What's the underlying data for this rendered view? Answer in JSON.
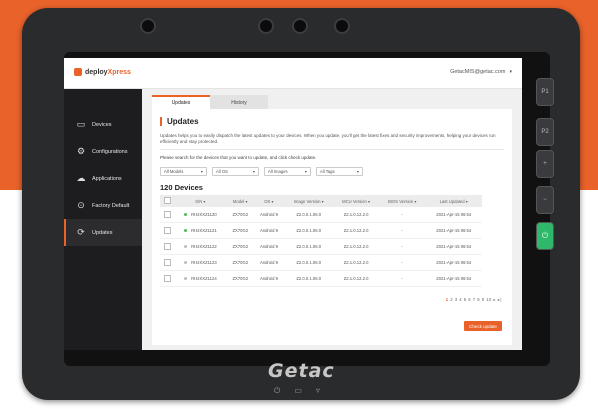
{
  "colors": {
    "accent": "#e8622a",
    "online": "#4bbd5a",
    "offline": "#bdbdbd"
  },
  "device": {
    "brand": "Getac"
  },
  "hardware_buttons": [
    "P1",
    "P2",
    "+",
    "−",
    "⏻"
  ],
  "app": {
    "logo": {
      "prefix": "deploy",
      "suffix": "Xpress"
    },
    "user": {
      "email": "GetacMIS@getac.com",
      "caret": "▾"
    }
  },
  "sidebar": {
    "items": [
      {
        "label": "Devices",
        "icon": "devices-icon",
        "glyph": "▭"
      },
      {
        "label": "Configurations",
        "icon": "configurations-icon",
        "glyph": "⚙"
      },
      {
        "label": "Applications",
        "icon": "applications-icon",
        "glyph": "☁"
      },
      {
        "label": "Factory Default",
        "icon": "factory-default-icon",
        "glyph": "⊙"
      },
      {
        "label": "Updates",
        "icon": "updates-icon",
        "glyph": "⟳",
        "active": true
      }
    ]
  },
  "tabs": [
    {
      "label": "Updates",
      "active": true
    },
    {
      "label": "History",
      "active": false
    }
  ],
  "page": {
    "title": "Updates",
    "description": "Updates helps you to easily dispatch the latest updates to your devices. When you update, you'll get the latest fixes and security improvements, helping your devices run efficiently and stay protected.",
    "hint": "Please search for the devices that you want to update, and click check update.",
    "filters": [
      {
        "value": "All Models"
      },
      {
        "value": "All OS"
      },
      {
        "value": "All Images"
      },
      {
        "value": "All Tags"
      }
    ],
    "count_label": "120 Devices"
  },
  "table": {
    "headers": [
      "S/N",
      "Model",
      "OS",
      "Image Version",
      "MCU Version",
      "BIOS Version",
      "Last Updated"
    ],
    "rows": [
      {
        "status": "online",
        "sn": "RH2XXZ1120",
        "model": "ZX70G2",
        "os": "Android 9",
        "image": "Z2.0.0.1.06.0",
        "mcu": "Z2.1.0.12.2.0",
        "bios": "-",
        "updated": "2021-Apr-15 06:54"
      },
      {
        "status": "online",
        "sn": "RH2XXZ1121",
        "model": "ZX70G2",
        "os": "Android 9",
        "image": "Z2.0.0.1.06.0",
        "mcu": "Z2.1.0.12.2.0",
        "bios": "-",
        "updated": "2021-Apr-15 06:54"
      },
      {
        "status": "offline",
        "sn": "RH2XXZ1122",
        "model": "ZX70G2",
        "os": "Android 9",
        "image": "Z2.0.0.1.06.0",
        "mcu": "Z2.1.0.12.2.0",
        "bios": "-",
        "updated": "2021-Apr-15 06:54"
      },
      {
        "status": "offline",
        "sn": "RH2XXZ1123",
        "model": "ZX70G2",
        "os": "Android 9",
        "image": "Z2.0.0.1.06.0",
        "mcu": "Z2.1.0.12.2.0",
        "bios": "-",
        "updated": "2021-Apr-15 06:54"
      },
      {
        "status": "offline",
        "sn": "RH2XXZ1124",
        "model": "ZX70G2",
        "os": "Android 9",
        "image": "Z2.0.0.1.06.0",
        "mcu": "Z2.1.0.12.2.0",
        "bios": "-",
        "updated": "2021-Apr-15 06:54"
      }
    ]
  },
  "pagination": {
    "current": "1",
    "pages": "2 3 4 5 6 7 8 9 10",
    "arrows": "▸ ▸|"
  },
  "action_button": "Check update"
}
